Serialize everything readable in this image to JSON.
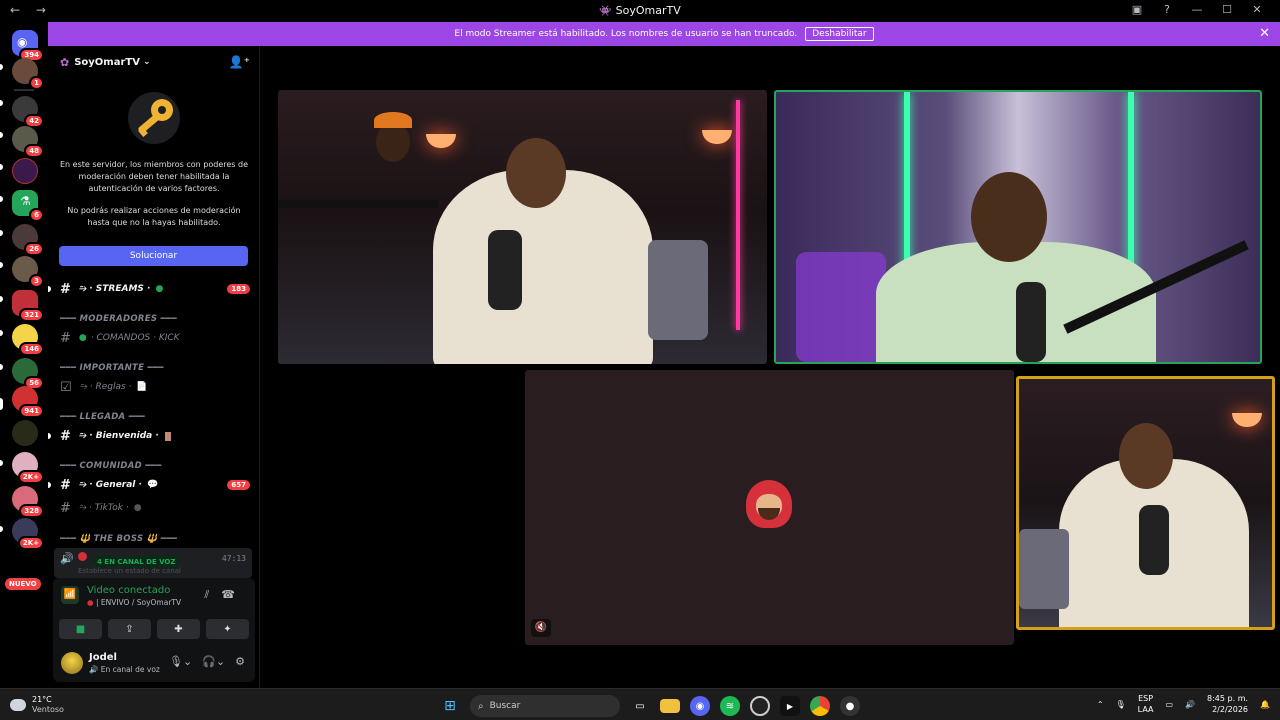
{
  "window": {
    "title": "SoyOmarTV"
  },
  "banner": {
    "text": "El modo Streamer está habilitado. Los nombres de usuario se han truncado.",
    "button": "Deshabilitar"
  },
  "guilds": [
    {
      "badge": "394"
    },
    {
      "badge": "1"
    },
    {
      "badge": "42"
    },
    {
      "badge": "48"
    },
    {
      "badge": ""
    },
    {
      "badge": "6"
    },
    {
      "badge": "26"
    },
    {
      "badge": "3"
    },
    {
      "badge": "321"
    },
    {
      "badge": "146"
    },
    {
      "badge": "56"
    },
    {
      "badge": "941"
    },
    {
      "badge": ""
    },
    {
      "badge": "2K+"
    },
    {
      "badge": "328"
    },
    {
      "badge": "2K+"
    }
  ],
  "guild_new_label": "NUEVO",
  "server": {
    "name": "SoyOmarTV"
  },
  "mfa": {
    "line1": "En este servidor, los miembros con poderes de moderación deben tener habilitada la autenticación de varios factores.",
    "line2": "No podrás realizar acciones de moderación hasta que no la hayas habilitado.",
    "button": "Solucionar"
  },
  "channels": {
    "streams": {
      "name": "⥲ · STREAMS ·",
      "badge": "183"
    },
    "cat_mod": "━━━ MODERADORES ━━━",
    "comandos": "· COMANDOS · KICK",
    "cat_imp": "━━━ IMPORTANTE ━━━",
    "reglas": "⥲ · Reglas ·",
    "cat_llegada": "━━━ LLEGADA ━━━",
    "bienvenida": "⥲ · Bienvenida ·",
    "cat_comunidad": "━━━ COMUNIDAD ━━━",
    "general": {
      "name": "⥲ · General ·",
      "badge": "657"
    },
    "tiktok": "⥲ · TikTok ·",
    "cat_boss": "━━━ 🔱 THE BOSS 🔱 ━━━"
  },
  "voice_channel": {
    "label": "4 EN CANAL DE VOZ",
    "time": "47:13",
    "sub": "Establece un estado de canal"
  },
  "rtc": {
    "title": "Video conectado",
    "sub": "| ENVIVO / SoyOmarTV"
  },
  "user": {
    "name": "Jodel",
    "status": "En canal de voz"
  },
  "taskbar": {
    "temp": "21°C",
    "condition": "Ventoso",
    "search": "Buscar",
    "lang1": "ESP",
    "lang2": "LAA",
    "time": "8:45 p. m.",
    "date": "2/2/2026"
  },
  "colors": {
    "banner": "#9b46e5",
    "accent": "#5865f2",
    "speaking": "#23a55a",
    "focus_tile": "#d4a017",
    "badge": "#f23f43"
  }
}
